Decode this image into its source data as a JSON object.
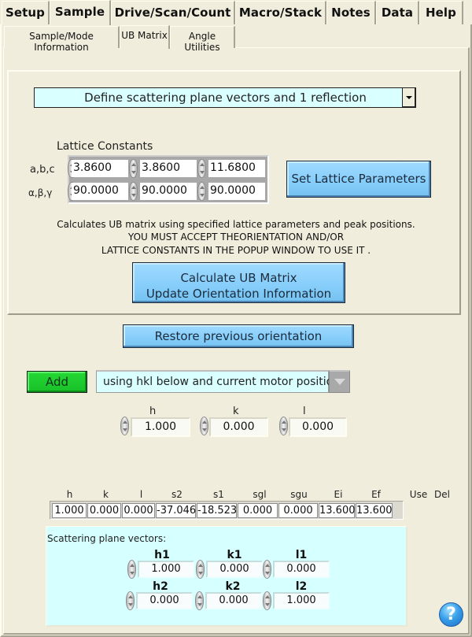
{
  "main_tabs": [
    {
      "label": "Setup",
      "active": false
    },
    {
      "label": "Sample",
      "active": true
    },
    {
      "label": "Drive/Scan/Count",
      "active": false
    },
    {
      "label": "Macro/Stack",
      "active": false
    },
    {
      "label": "Notes",
      "active": false
    },
    {
      "label": "Data",
      "active": false
    },
    {
      "label": "Help",
      "active": false
    }
  ],
  "sub_tabs": [
    {
      "label": "Sample/Mode Information",
      "active": false
    },
    {
      "label": "UB Matrix",
      "active": true
    },
    {
      "label": "Angle Utilities",
      "active": false
    }
  ],
  "mode_select": {
    "value": "Define scattering plane vectors and 1 reflection"
  },
  "lattice": {
    "title": "Lattice Constants",
    "abc_label": "a,b,c",
    "angles_label": "α,β,γ",
    "a": "3.8600",
    "b": "3.8600",
    "c": "11.6800",
    "alpha": "90.0000",
    "beta": "90.0000",
    "gamma": "90.0000",
    "set_button": "Set Lattice Parameters"
  },
  "description": {
    "line1": "Calculates UB matrix using specified lattice parameters and peak positions.",
    "line2": "YOU MUST ACCEPT THEORIENTATION AND/OR",
    "line3": "LATTICE CONSTANTS IN THE POPUP WINDOW TO USE IT ."
  },
  "calculate_button": {
    "line1": "Calculate UB Matrix",
    "line2": "Update Orientation Information"
  },
  "restore_button": "Restore previous orientation",
  "add": {
    "button": "Add",
    "mode": "using hkl below and current motor positions",
    "h_label": "h",
    "k_label": "k",
    "l_label": "l",
    "h": "1.000",
    "k": "0.000",
    "l": "0.000"
  },
  "reflections": {
    "headers": [
      "h",
      "k",
      "l",
      "s2",
      "s1",
      "sgl",
      "sgu",
      "Ei",
      "Ef",
      "Use",
      "Del"
    ],
    "rows": [
      [
        "1.000",
        "0.000",
        "0.000",
        "-37.046",
        "-18.523",
        "0.000",
        "0.000",
        "13.600",
        "13.600"
      ]
    ]
  },
  "scattering_plane": {
    "title": "Scattering plane vectors:",
    "labels": [
      "h1",
      "k1",
      "l1",
      "h2",
      "k2",
      "l2"
    ],
    "h1": "1.000",
    "k1": "0.000",
    "l1": "0.000",
    "h2": "0.000",
    "k2": "0.000",
    "l2": "1.000"
  },
  "help_icon": "?"
}
